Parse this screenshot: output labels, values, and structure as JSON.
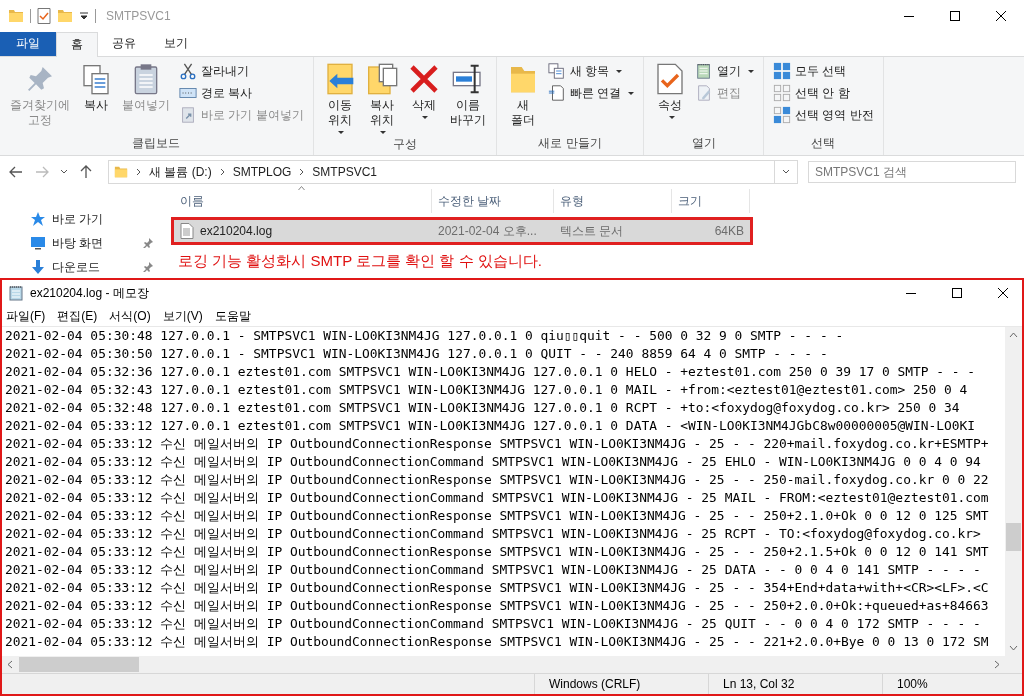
{
  "explorer": {
    "title": "SMTPSVC1",
    "ribbon_tabs": [
      {
        "label": "파일",
        "selected": false,
        "kind": "file"
      },
      {
        "label": "홈",
        "selected": true,
        "kind": "tab"
      },
      {
        "label": "공유",
        "selected": false,
        "kind": "tab"
      },
      {
        "label": "보기",
        "selected": false,
        "kind": "tab"
      }
    ],
    "ribbon_groups": [
      {
        "label": "클립보드",
        "items": [
          {
            "kind": "large",
            "label": "즐겨찾기에\n고정",
            "disabled": true,
            "dropdown": false
          },
          {
            "kind": "large",
            "label": "복사",
            "disabled": false,
            "dropdown": false
          },
          {
            "kind": "large",
            "label": "붙여넣기",
            "disabled": true,
            "dropdown": false
          },
          {
            "kind": "small",
            "label": "잘라내기",
            "disabled": false,
            "dropdown": false
          },
          {
            "kind": "small",
            "label": "경로 복사",
            "disabled": false,
            "dropdown": false
          },
          {
            "kind": "small",
            "label": "바로 가기 붙여넣기",
            "disabled": true,
            "dropdown": false
          }
        ]
      },
      {
        "label": "구성",
        "items": [
          {
            "kind": "large",
            "label": "이동\n위치",
            "disabled": false,
            "dropdown": true
          },
          {
            "kind": "large",
            "label": "복사\n위치",
            "disabled": false,
            "dropdown": true
          },
          {
            "kind": "large",
            "label": "삭제",
            "disabled": false,
            "dropdown": true
          },
          {
            "kind": "large",
            "label": "이름\n바꾸기",
            "disabled": false,
            "dropdown": false
          }
        ]
      },
      {
        "label": "새로 만들기",
        "items": [
          {
            "kind": "large",
            "label": "새\n폴더",
            "disabled": false,
            "dropdown": false
          },
          {
            "kind": "small",
            "label": "새 항목",
            "disabled": false,
            "dropdown": true
          },
          {
            "kind": "small",
            "label": "빠른 연결",
            "disabled": false,
            "dropdown": true
          }
        ]
      },
      {
        "label": "열기",
        "items": [
          {
            "kind": "large",
            "label": "속성",
            "disabled": false,
            "dropdown": true
          },
          {
            "kind": "small",
            "label": "열기",
            "disabled": false,
            "dropdown": true
          },
          {
            "kind": "small",
            "label": "편집",
            "disabled": true,
            "dropdown": false
          }
        ]
      },
      {
        "label": "선택",
        "items": [
          {
            "kind": "small",
            "label": "모두 선택",
            "disabled": false,
            "dropdown": false
          },
          {
            "kind": "small",
            "label": "선택 안 함",
            "disabled": false,
            "dropdown": false
          },
          {
            "kind": "small",
            "label": "선택 영역 반전",
            "disabled": false,
            "dropdown": false
          }
        ]
      }
    ],
    "path": [
      "새 볼륨 (D:)",
      "SMTPLOG",
      "SMTPSVC1"
    ],
    "search": {
      "placeholder": "SMTPSVC1 검색"
    },
    "nav": [
      {
        "label": "바로 가기",
        "pinned": false
      },
      {
        "label": "바탕 화면",
        "pinned": true
      },
      {
        "label": "다운로드",
        "pinned": true
      }
    ],
    "columns": [
      "이름",
      "수정한 날짜",
      "유형",
      "크기"
    ],
    "files": [
      {
        "name": "ex210204.log",
        "modified": "2021-02-04 오후...",
        "type": "텍스트 문서",
        "size": "64KB",
        "selected": true
      }
    ],
    "annotation": "로깅 기능 활성화시 SMTP 로그를 확인 할 수 있습니다."
  },
  "notepad": {
    "title": "ex210204.log - 메모장",
    "menu": [
      "파일(F)",
      "편집(E)",
      "서식(O)",
      "보기(V)",
      "도움말"
    ],
    "lines": [
      "2021-02-04 05:30:48 127.0.0.1 - SMTPSVC1 WIN-LO0KI3NM4JG 127.0.0.1 0 qiu▯▯quit - - 500 0 32 9 0 SMTP - - - -",
      "2021-02-04 05:30:50 127.0.0.1 - SMTPSVC1 WIN-LO0KI3NM4JG 127.0.0.1 0 QUIT - - 240 8859 64 4 0 SMTP - - - -",
      "2021-02-04 05:32:36 127.0.0.1 eztest01.com SMTPSVC1 WIN-LO0KI3NM4JG 127.0.0.1 0 HELO - +eztest01.com 250 0 39 17 0 SMTP - - -",
      "2021-02-04 05:32:43 127.0.0.1 eztest01.com SMTPSVC1 WIN-LO0KI3NM4JG 127.0.0.1 0 MAIL - +from:<eztest01@eztest01.com> 250 0 4",
      "2021-02-04 05:32:48 127.0.0.1 eztest01.com SMTPSVC1 WIN-LO0KI3NM4JG 127.0.0.1 0 RCPT - +to:<foxydog@foxydog.co.kr> 250 0 34",
      "2021-02-04 05:33:12 127.0.0.1 eztest01.com SMTPSVC1 WIN-LO0KI3NM4JG 127.0.0.1 0 DATA - <WIN-LO0KI3NM4JGbC8w00000005@WIN-LO0KI",
      "2021-02-04 05:33:12 수신 메일서버의 IP OutboundConnectionResponse SMTPSVC1 WIN-LO0KI3NM4JG - 25 - - 220+mail.foxydog.co.kr+ESMTP+",
      "2021-02-04 05:33:12 수신 메일서버의 IP OutboundConnectionCommand SMTPSVC1 WIN-LO0KI3NM4JG - 25 EHLO - WIN-LO0KI3NM4JG 0 0 4 0 94",
      "2021-02-04 05:33:12 수신 메일서버의 IP OutboundConnectionResponse SMTPSVC1 WIN-LO0KI3NM4JG - 25 - - 250-mail.foxydog.co.kr 0 0 22",
      "2021-02-04 05:33:12 수신 메일서버의 IP OutboundConnectionCommand SMTPSVC1 WIN-LO0KI3NM4JG - 25 MAIL - FROM:<eztest01@eztest01.com",
      "2021-02-04 05:33:12 수신 메일서버의 IP OutboundConnectionResponse SMTPSVC1 WIN-LO0KI3NM4JG - 25 - - 250+2.1.0+Ok 0 0 12 0 125 SMT",
      "2021-02-04 05:33:12 수신 메일서버의 IP OutboundConnectionCommand SMTPSVC1 WIN-LO0KI3NM4JG - 25 RCPT - TO:<foxydog@foxydog.co.kr>",
      "2021-02-04 05:33:12 수신 메일서버의 IP OutboundConnectionResponse SMTPSVC1 WIN-LO0KI3NM4JG - 25 - - 250+2.1.5+Ok 0 0 12 0 141 SMT",
      "2021-02-04 05:33:12 수신 메일서버의 IP OutboundConnectionCommand SMTPSVC1 WIN-LO0KI3NM4JG - 25 DATA - - 0 0 4 0 141 SMTP - - - -",
      "2021-02-04 05:33:12 수신 메일서버의 IP OutboundConnectionResponse SMTPSVC1 WIN-LO0KI3NM4JG - 25 - - 354+End+data+with+<CR><LF>.<C",
      "2021-02-04 05:33:12 수신 메일서버의 IP OutboundConnectionResponse SMTPSVC1 WIN-LO0KI3NM4JG - 25 - - 250+2.0.0+Ok:+queued+as+84663",
      "2021-02-04 05:33:12 수신 메일서버의 IP OutboundConnectionCommand SMTPSVC1 WIN-LO0KI3NM4JG - 25 QUIT - - 0 0 4 0 172 SMTP - - - -",
      "2021-02-04 05:33:12 수신 메일서버의 IP OutboundConnectionResponse SMTPSVC1 WIN-LO0KI3NM4JG - 25 - - 221+2.0.0+Bye 0 0 13 0 172 SM"
    ],
    "status": [
      "Windows (CRLF)",
      "Ln 13, Col 32",
      "100%"
    ]
  }
}
